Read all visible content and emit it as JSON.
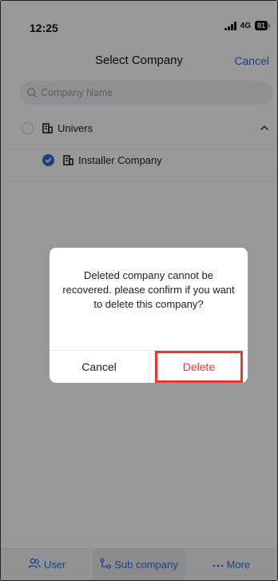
{
  "status_bar": {
    "time": "12:25",
    "network": "4G",
    "battery": "81"
  },
  "header": {
    "title": "Select Company",
    "cancel_label": "Cancel"
  },
  "search": {
    "placeholder": "Company Name",
    "value": ""
  },
  "company_list": [
    {
      "label": "Univers",
      "selected": false,
      "expanded": true
    },
    {
      "label": "Installer Company",
      "selected": true
    }
  ],
  "bottom_nav": {
    "user_label": "User",
    "sub_company_label": "Sub company",
    "more_label": "More"
  },
  "dialog": {
    "message": "Deleted company cannot be recovered. please confirm if you want to delete this company?",
    "cancel_label": "Cancel",
    "delete_label": "Delete"
  },
  "colors": {
    "accent": "#2f6bd8",
    "danger": "#e63939",
    "highlight": "#e53935"
  }
}
